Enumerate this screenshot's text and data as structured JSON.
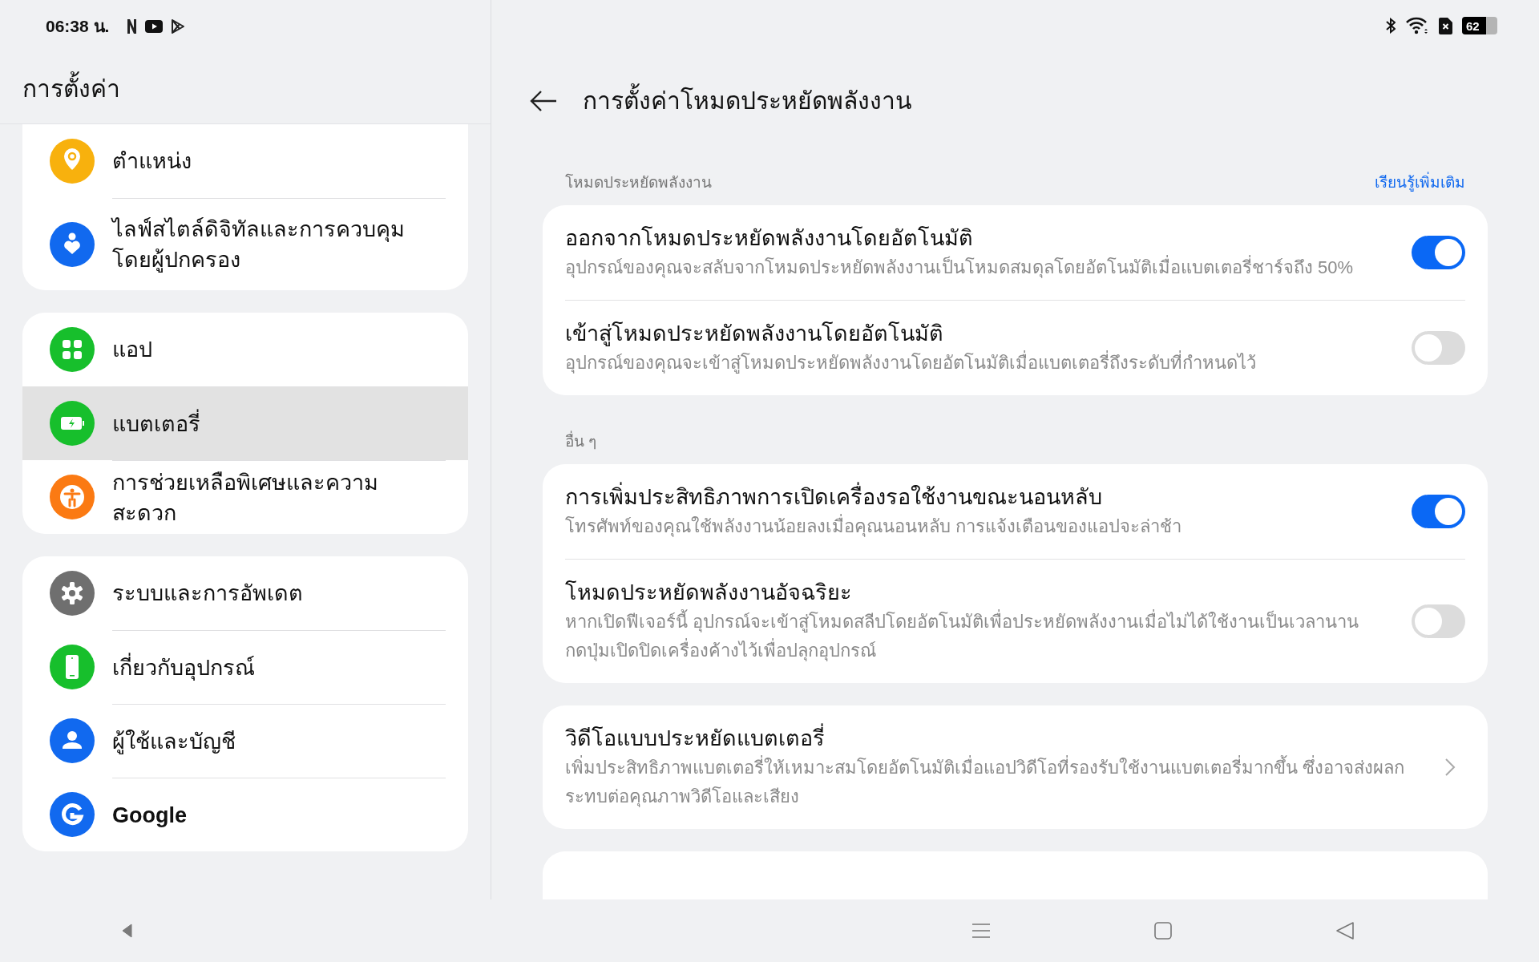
{
  "status_bar": {
    "time": "06:38 น.",
    "battery": "62"
  },
  "sidebar": {
    "title": "การตั้งค่า",
    "groups": [
      {
        "items": [
          {
            "label": "ตำแหน่ง",
            "color": "#f8b10d",
            "selected": false
          },
          {
            "label": "ไลฟ์สไตล์ดิจิทัลและการควบคุมโดยผู้ปกครอง",
            "color": "#1169ef",
            "selected": false
          }
        ]
      },
      {
        "items": [
          {
            "label": "แอป",
            "color": "#17bf2c",
            "selected": false
          },
          {
            "label": "แบตเตอรี่",
            "color": "#17bf2c",
            "selected": true
          },
          {
            "label": "การช่วยเหลือพิเศษและความสะดวก",
            "color": "#fb7a13",
            "selected": false
          }
        ]
      },
      {
        "items": [
          {
            "label": "ระบบและการอัพเดต",
            "color": "#6f6f6f",
            "selected": false
          },
          {
            "label": "เกี่ยวกับอุปกรณ์",
            "color": "#17bf2c",
            "selected": false
          },
          {
            "label": "ผู้ใช้และบัญชี",
            "color": "#1169ef",
            "selected": false
          },
          {
            "label": "Google",
            "color": "#1169ef",
            "selected": false
          }
        ]
      }
    ]
  },
  "page": {
    "title": "การตั้งค่าโหมดประหยัดพลังงาน",
    "sections": [
      {
        "label": "โหมดประหยัดพลังงาน",
        "link": "เรียนรู้เพิ่มเติม",
        "rows": [
          {
            "kind": "toggle",
            "title": "ออกจากโหมดประหยัดพลังงานโดยอัตโนมัติ",
            "description": "อุปกรณ์ของคุณจะสลับจากโหมดประหยัดพลังงานเป็นโหมดสมดุลโดยอัตโนมัติเมื่อแบตเตอรี่ชาร์จถึง 50%",
            "on": true
          },
          {
            "kind": "toggle",
            "title": "เข้าสู่โหมดประหยัดพลังงานโดยอัตโนมัติ",
            "description": "อุปกรณ์ของคุณจะเข้าสู่โหมดประหยัดพลังงานโดยอัตโนมัติเมื่อแบตเตอรี่ถึงระดับที่กำหนดไว้",
            "on": false
          }
        ]
      },
      {
        "label": "อื่น ๆ",
        "rows": [
          {
            "kind": "toggle",
            "title": "การเพิ่มประสิทธิภาพการเปิดเครื่องรอใช้งานขณะนอนหลับ",
            "description": "โทรศัพท์ของคุณใช้พลังงานน้อยลงเมื่อคุณนอนหลับ การแจ้งเตือนของแอปจะล่าช้า",
            "on": true
          },
          {
            "kind": "toggle",
            "title": "โหมดประหยัดพลังงานอัจฉริยะ",
            "description": "หากเปิดฟีเจอร์นี้ อุปกรณ์จะเข้าสู่โหมดสลีปโดยอัตโนมัติเพื่อประหยัดพลังงานเมื่อไม่ได้ใช้งานเป็นเวลานาน กดปุ่มเปิดปิดเครื่องค้างไว้เพื่อปลุกอุปกรณ์",
            "on": false
          }
        ]
      },
      {
        "rows": [
          {
            "kind": "link",
            "title": "วิดีโอแบบประหยัดแบตเตอรี่",
            "description": "เพิ่มประสิทธิภาพแบตเตอรี่ให้เหมาะสมโดยอัตโนมัติเมื่อแอปวิดีโอที่รองรับใช้งานแบตเตอรี่มากขึ้น ซึ่งอาจส่งผลกระทบต่อคุณภาพวิดีโอและเสียง"
          }
        ]
      }
    ]
  }
}
